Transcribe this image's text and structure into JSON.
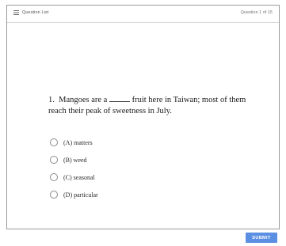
{
  "header": {
    "question_list_label": "Question List",
    "question_counter": "Question 1 of 15"
  },
  "question": {
    "number": "1.",
    "text_before_blank": "Mangoes are a",
    "text_after_blank": "fruit here in Taiwan; most of them reach their peak of sweetness in July.",
    "options": [
      {
        "label": "(A) matters"
      },
      {
        "label": "(B) weed"
      },
      {
        "label": "(C) seasonal"
      },
      {
        "label": "(D) particular"
      }
    ]
  },
  "footer": {
    "submit_label": "SUBMIT"
  },
  "colors": {
    "accent": "#5b8fe3"
  }
}
